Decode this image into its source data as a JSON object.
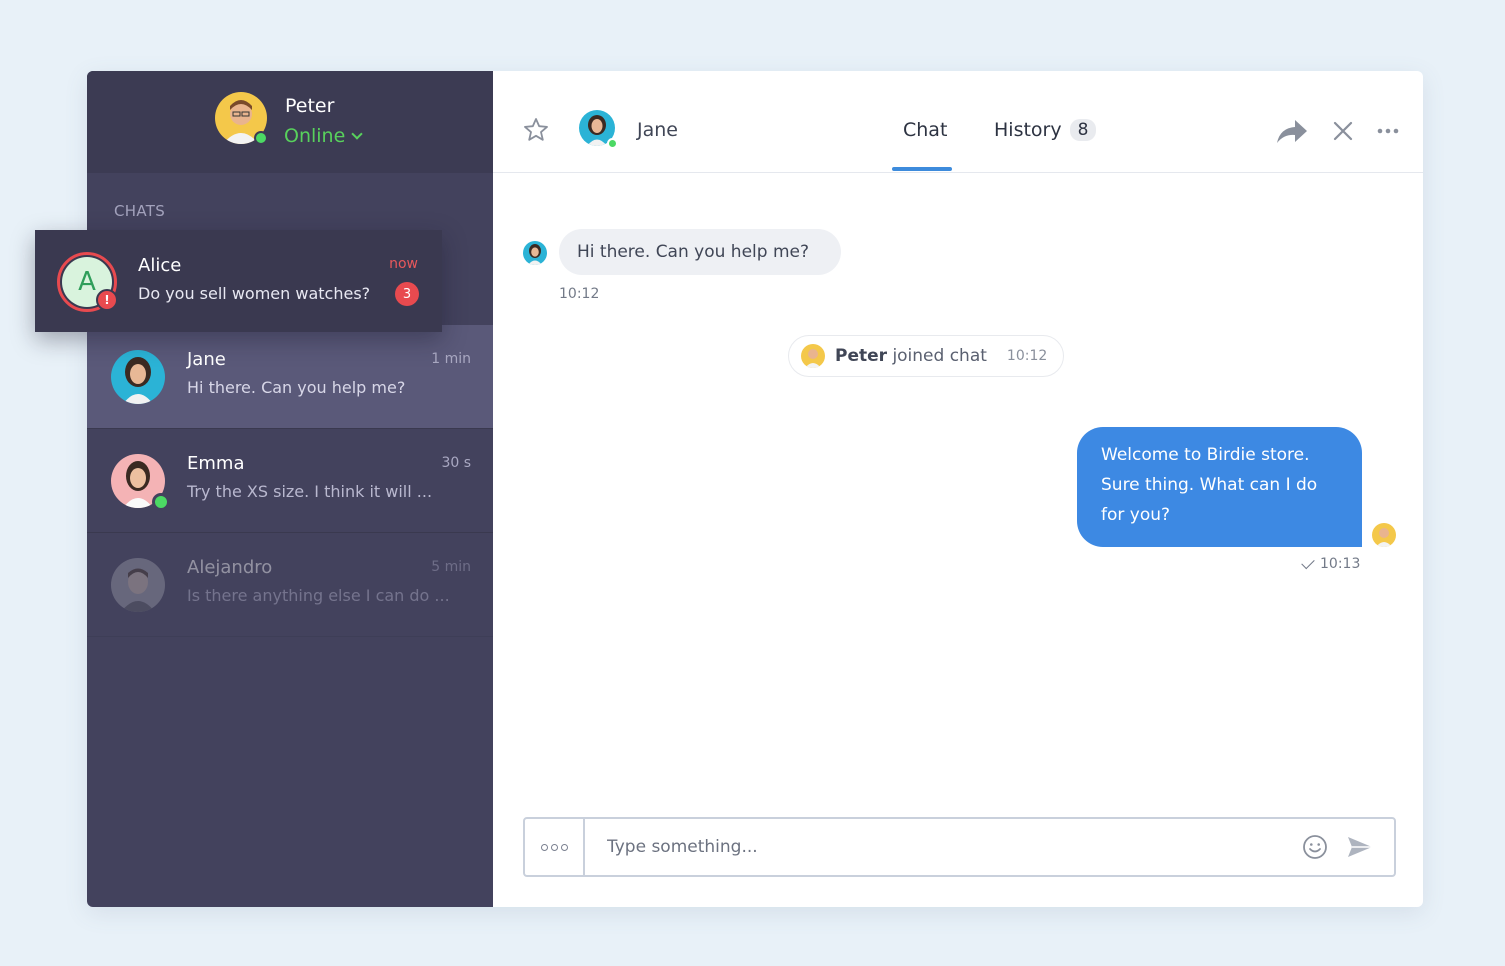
{
  "profile": {
    "name": "Peter",
    "status": "Online"
  },
  "sidebar": {
    "section_label": "CHATS",
    "notification": {
      "avatar_letter": "A",
      "alert": "!",
      "name": "Alice",
      "message": "Do you sell women watches?",
      "time": "now",
      "unread": "3"
    },
    "items": [
      {
        "name": "Jane",
        "message": "Hi there. Can you help me?",
        "time": "1 min"
      },
      {
        "name": "Emma",
        "message": "Try the XS size. I think it will ...",
        "time": "30 s"
      },
      {
        "name": "Alejandro",
        "message": "Is there anything else I can do ...",
        "time": "5 min"
      }
    ]
  },
  "header": {
    "contact_name": "Jane",
    "tabs": [
      {
        "label": "Chat"
      },
      {
        "label": "History",
        "count": "8"
      }
    ]
  },
  "messages": {
    "incoming": {
      "text": "Hi there. Can you help me?",
      "time": "10:12"
    },
    "system": {
      "name": "Peter",
      "text": "joined chat",
      "time": "10:12"
    },
    "outgoing": {
      "text": "Welcome to Birdie store. Sure thing. What can I do for you?",
      "time": "10:13"
    }
  },
  "composer": {
    "placeholder": "Type something..."
  },
  "colors": {
    "accent": "#3d89e3",
    "sidebar": "#43425d",
    "online": "#4cd964",
    "alert": "#e84a4f"
  }
}
